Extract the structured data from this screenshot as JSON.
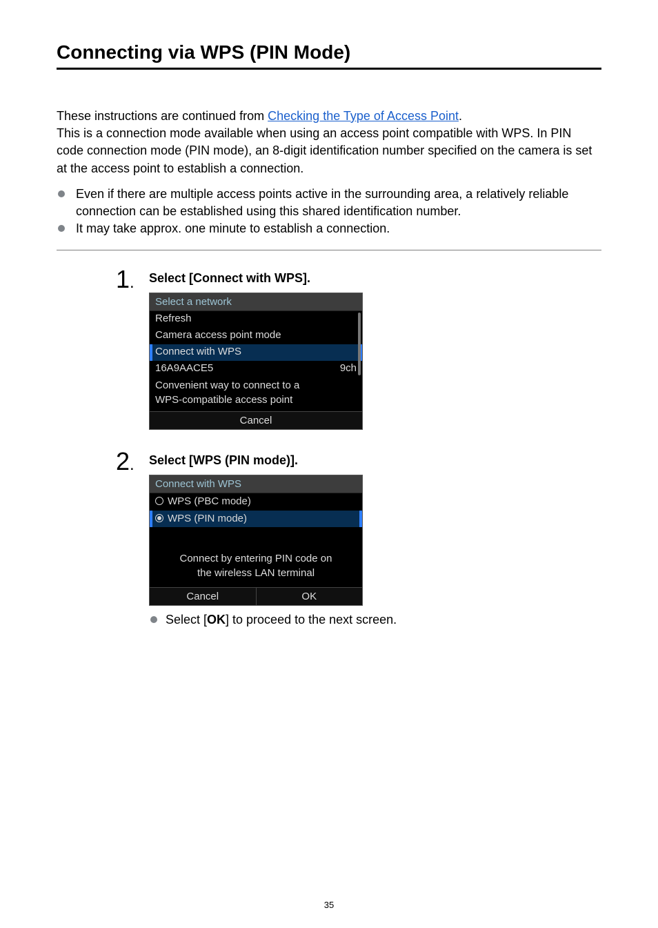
{
  "title": "Connecting via WPS (PIN Mode)",
  "intro": {
    "line1_pre": "These instructions are continued from ",
    "link_text": "Checking the Type of Access Point",
    "line1_post": ".",
    "line2": "This is a connection mode available when using an access point compatible with WPS. In PIN code connection mode (PIN mode), an 8-digit identification number specified on the camera is set at the access point to establish a connection."
  },
  "bullets": [
    "Even if there are multiple access points active in the surrounding area, a relatively reliable connection can be established using this shared identification number.",
    "It may take approx. one minute to establish a connection."
  ],
  "steps": [
    {
      "num": "1",
      "title": "Select [Connect with WPS].",
      "lcd": {
        "header": "Select a network",
        "items": [
          {
            "label": "Refresh",
            "selected": false
          },
          {
            "label": "Camera access point mode",
            "selected": false
          },
          {
            "label": "Connect with WPS",
            "selected": true
          },
          {
            "label": "16A9AACE5",
            "right": "9ch",
            "selected": false
          }
        ],
        "desc1": "Convenient way to connect to a",
        "desc2": "WPS-compatible access point",
        "cancel": "Cancel"
      }
    },
    {
      "num": "2",
      "title": "Select [WPS (PIN mode)].",
      "lcd": {
        "header": "Connect with WPS",
        "radio": [
          {
            "label": "WPS (PBC mode)",
            "selected": false
          },
          {
            "label": "WPS (PIN mode)",
            "selected": true
          }
        ],
        "desc1": "Connect by entering PIN code on",
        "desc2": "the wireless LAN terminal",
        "cancel": "Cancel",
        "ok": "OK"
      },
      "note_pre": "Select [",
      "note_bold": "OK",
      "note_post": "] to proceed to the next screen."
    }
  ],
  "page_num": "35"
}
